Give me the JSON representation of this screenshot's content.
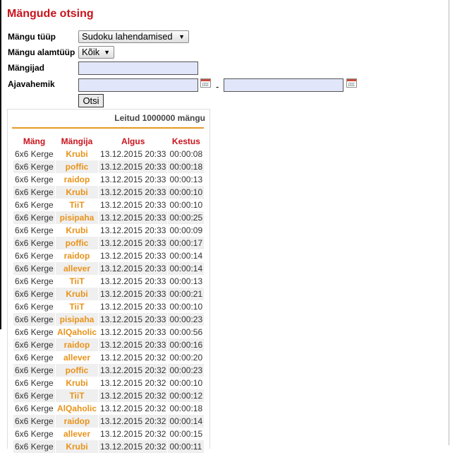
{
  "title": "Mängude otsing",
  "form": {
    "type_label": "Mängu tüüp",
    "type_value": "Sudoku lahendamised",
    "subtype_label": "Mängu alamtüüp",
    "subtype_value": "Kõik",
    "players_label": "Mängijad",
    "players_value": "",
    "range_label": "Ajavahemik",
    "range_from": "",
    "range_to": "",
    "range_separator": "-",
    "search_button": "Otsi"
  },
  "results": {
    "count_text": "Leitud 1000000 mängu",
    "headers": [
      "Mäng",
      "Mängija",
      "Algus",
      "Kestus"
    ],
    "rows": [
      {
        "game": "6x6 Kerge",
        "player": "Krubi",
        "start": "13.12.2015 20:33",
        "duration": "00:00:08"
      },
      {
        "game": "6x6 Kerge",
        "player": "poffic",
        "start": "13.12.2015 20:33",
        "duration": "00:00:18"
      },
      {
        "game": "6x6 Kerge",
        "player": "raidop",
        "start": "13.12.2015 20:33",
        "duration": "00:00:13"
      },
      {
        "game": "6x6 Kerge",
        "player": "Krubi",
        "start": "13.12.2015 20:33",
        "duration": "00:00:10"
      },
      {
        "game": "6x6 Kerge",
        "player": "TiiT",
        "start": "13.12.2015 20:33",
        "duration": "00:00:10"
      },
      {
        "game": "6x6 Kerge",
        "player": "pisipaha",
        "start": "13.12.2015 20:33",
        "duration": "00:00:25"
      },
      {
        "game": "6x6 Kerge",
        "player": "Krubi",
        "start": "13.12.2015 20:33",
        "duration": "00:00:09"
      },
      {
        "game": "6x6 Kerge",
        "player": "poffic",
        "start": "13.12.2015 20:33",
        "duration": "00:00:17"
      },
      {
        "game": "6x6 Kerge",
        "player": "raidop",
        "start": "13.12.2015 20:33",
        "duration": "00:00:14"
      },
      {
        "game": "6x6 Kerge",
        "player": "allever",
        "start": "13.12.2015 20:33",
        "duration": "00:00:14"
      },
      {
        "game": "6x6 Kerge",
        "player": "TiiT",
        "start": "13.12.2015 20:33",
        "duration": "00:00:13"
      },
      {
        "game": "6x6 Kerge",
        "player": "Krubi",
        "start": "13.12.2015 20:33",
        "duration": "00:00:21"
      },
      {
        "game": "6x6 Kerge",
        "player": "TiiT",
        "start": "13.12.2015 20:33",
        "duration": "00:00:10"
      },
      {
        "game": "6x6 Kerge",
        "player": "pisipaha",
        "start": "13.12.2015 20:33",
        "duration": "00:00:23"
      },
      {
        "game": "6x6 Kerge",
        "player": "AlQaholic",
        "start": "13.12.2015 20:33",
        "duration": "00:00:56"
      },
      {
        "game": "6x6 Kerge",
        "player": "raidop",
        "start": "13.12.2015 20:33",
        "duration": "00:00:16"
      },
      {
        "game": "6x6 Kerge",
        "player": "allever",
        "start": "13.12.2015 20:32",
        "duration": "00:00:20"
      },
      {
        "game": "6x6 Kerge",
        "player": "poffic",
        "start": "13.12.2015 20:32",
        "duration": "00:00:23"
      },
      {
        "game": "6x6 Kerge",
        "player": "Krubi",
        "start": "13.12.2015 20:32",
        "duration": "00:00:10"
      },
      {
        "game": "6x6 Kerge",
        "player": "TiiT",
        "start": "13.12.2015 20:32",
        "duration": "00:00:12"
      },
      {
        "game": "6x6 Kerge",
        "player": "AlQaholic",
        "start": "13.12.2015 20:32",
        "duration": "00:00:18"
      },
      {
        "game": "6x6 Kerge",
        "player": "raidop",
        "start": "13.12.2015 20:32",
        "duration": "00:00:14"
      },
      {
        "game": "6x6 Kerge",
        "player": "allever",
        "start": "13.12.2015 20:32",
        "duration": "00:00:15"
      },
      {
        "game": "6x6 Kerge",
        "player": "Krubi",
        "start": "13.12.2015 20:32",
        "duration": "00:00:11"
      }
    ]
  },
  "icons": {
    "dropdown": "chevron-down-icon",
    "calendar": "calendar-icon"
  },
  "colors": {
    "title": "#c8141d",
    "player_link": "#e8931a",
    "divider": "#e59a25",
    "input_bg": "#e2e6fa"
  }
}
